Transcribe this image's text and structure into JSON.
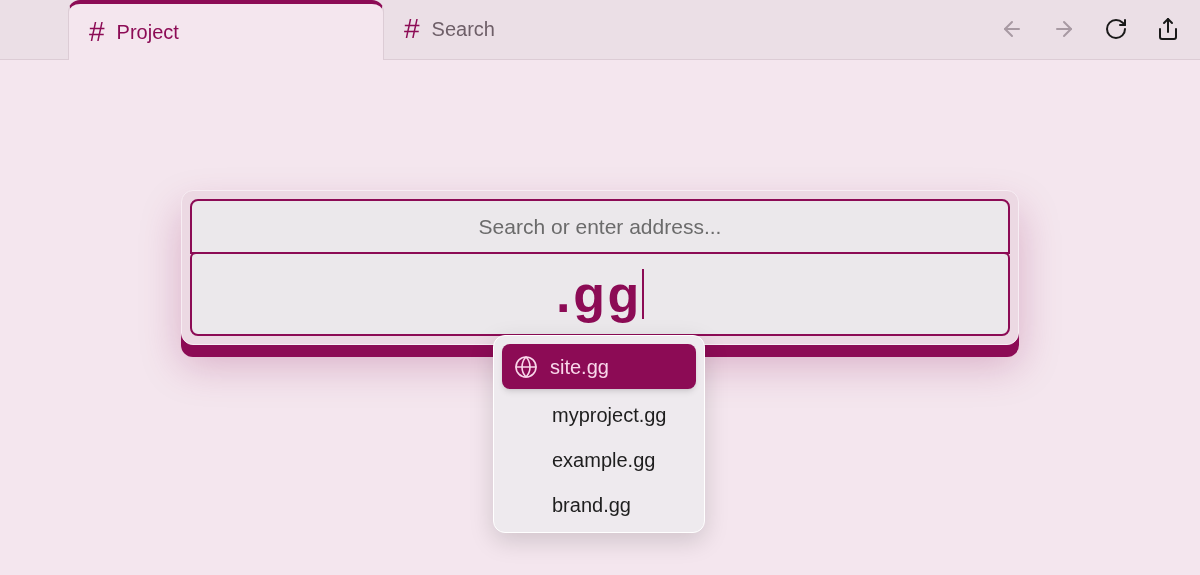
{
  "tabs": [
    {
      "icon": "#",
      "label": "Project",
      "selected": true
    },
    {
      "icon": "#",
      "label": "Search",
      "selected": false
    }
  ],
  "toolbar": [
    {
      "kind": "back",
      "disabled": true
    },
    {
      "kind": "forward",
      "disabled": true
    },
    {
      "kind": "reload",
      "disabled": false
    },
    {
      "kind": "share",
      "disabled": false
    }
  ],
  "search": {
    "placeholder": "Search or enter address...",
    "value": ".gg"
  },
  "suggestions": [
    {
      "label": "site.gg",
      "selected": true
    },
    {
      "label": "myproject.gg",
      "selected": false
    },
    {
      "label": "example.gg",
      "selected": false
    },
    {
      "label": "brand.gg",
      "selected": false
    }
  ]
}
